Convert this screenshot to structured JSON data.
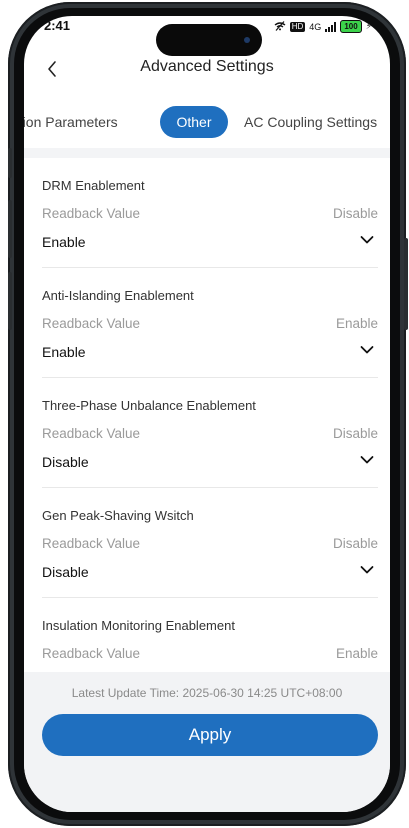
{
  "status": {
    "time": "2:41",
    "icons": [
      "wifi-off-icon",
      "hd-icon",
      "signal-4g-icon",
      "battery-icon",
      "charging-icon"
    ],
    "network": "4G",
    "hd": "HD",
    "battery": "100"
  },
  "header": {
    "title": "Advanced Settings",
    "back_icon": "chevron-left-icon"
  },
  "tabs": [
    {
      "label": "ection Parameters",
      "active": false
    },
    {
      "label": "Other",
      "active": true
    },
    {
      "label": "AC Coupling Settings",
      "active": false
    }
  ],
  "colors": {
    "accent": "#1f6fbf",
    "muted_text": "#9a9a9a",
    "panel_bg": "#f2f3f5"
  },
  "settings": [
    {
      "title": "DRM Enablement",
      "readback_label": "Readback Value",
      "readback_value": "Disable",
      "selected": "Enable"
    },
    {
      "title": "Anti-Islanding Enablement",
      "readback_label": "Readback Value",
      "readback_value": "Enable",
      "selected": "Enable"
    },
    {
      "title": "Three-Phase Unbalance Enablement",
      "readback_label": "Readback Value",
      "readback_value": "Disable",
      "selected": "Disable"
    },
    {
      "title": "Gen Peak-Shaving Wsitch",
      "readback_label": "Readback Value",
      "readback_value": "Disable",
      "selected": "Disable"
    },
    {
      "title": "Insulation Monitoring Enablement",
      "readback_label": "Readback Value",
      "readback_value": "Enable"
    }
  ],
  "footer": {
    "update_time": "Latest Update Time: 2025-06-30 14:25 UTC+08:00",
    "apply_label": "Apply"
  }
}
